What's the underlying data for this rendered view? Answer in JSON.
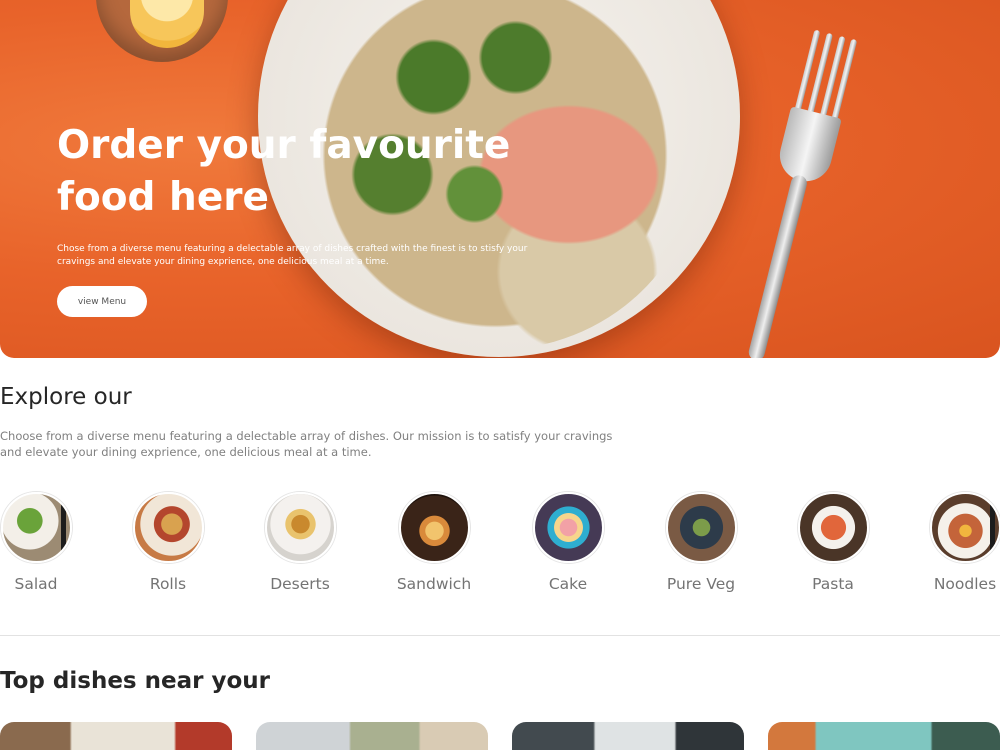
{
  "hero": {
    "title": "Order your favourite food here",
    "description": "Chose from a diverse menu featuring a delectable array of dishes crafted with the finest is to stisfy your cravings and elevate your dining exprience, one delicious meal at a time.",
    "button_label": "view Menu"
  },
  "explore": {
    "title": "Explore our",
    "description": "Choose from a diverse menu featuring a delectable array of dishes. Our mission is to satisfy your cravings and elevate your dining exprience, one delicious meal at a time.",
    "items": [
      {
        "label": "Salad"
      },
      {
        "label": "Rolls"
      },
      {
        "label": "Deserts"
      },
      {
        "label": "Sandwich"
      },
      {
        "label": "Cake"
      },
      {
        "label": "Pure Veg"
      },
      {
        "label": "Pasta"
      },
      {
        "label": "Noodles"
      }
    ]
  },
  "top_dishes": {
    "title": "Top dishes near your"
  }
}
